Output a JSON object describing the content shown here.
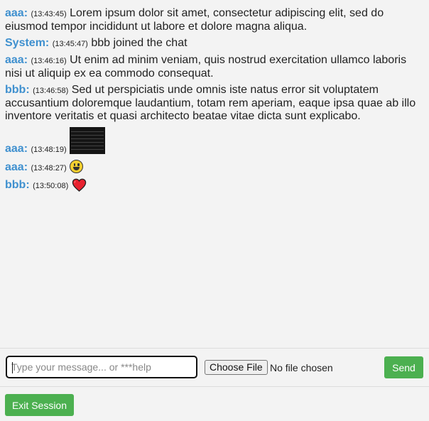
{
  "messages": [
    {
      "user": "aaa:",
      "time": "(13:43:45)",
      "text": "Lorem ipsum dolor sit amet, consectetur adipiscing elit, sed do eiusmod tempor incididunt ut labore et dolore magna aliqua."
    },
    {
      "user": "System:",
      "time": "(13:45:47)",
      "text": "bbb joined the chat"
    },
    {
      "user": "aaa:",
      "time": "(13:46:16)",
      "text": "Ut enim ad minim veniam, quis nostrud exercitation ullamco laboris nisi ut aliquip ex ea commodo consequat."
    },
    {
      "user": "bbb:",
      "time": "(13:46:58)",
      "text": "Sed ut perspiciatis unde omnis iste natus error sit voluptatem accusantium doloremque laudantium, totam rem aperiam, eaque ipsa quae ab illo inventore veritatis et quasi architecto beatae vitae dicta sunt explicabo."
    },
    {
      "user": "aaa:",
      "time": "(13:48:19)",
      "attachment": "image-thumbnail"
    },
    {
      "user": "aaa:",
      "time": "(13:48:27)",
      "attachment": "smiley-emoji"
    },
    {
      "user": "bbb:",
      "time": "(13:50:08)",
      "attachment": "heart-emoji"
    }
  ],
  "composer": {
    "placeholder": "Type your message... or ***help",
    "file_button_label": "Choose File",
    "file_status": "No file chosen",
    "send_label": "Send"
  },
  "footer": {
    "exit_label": "Exit Session"
  },
  "colors": {
    "username": "#3f90cf",
    "button": "#4cb050",
    "background": "#f3f3f3"
  }
}
